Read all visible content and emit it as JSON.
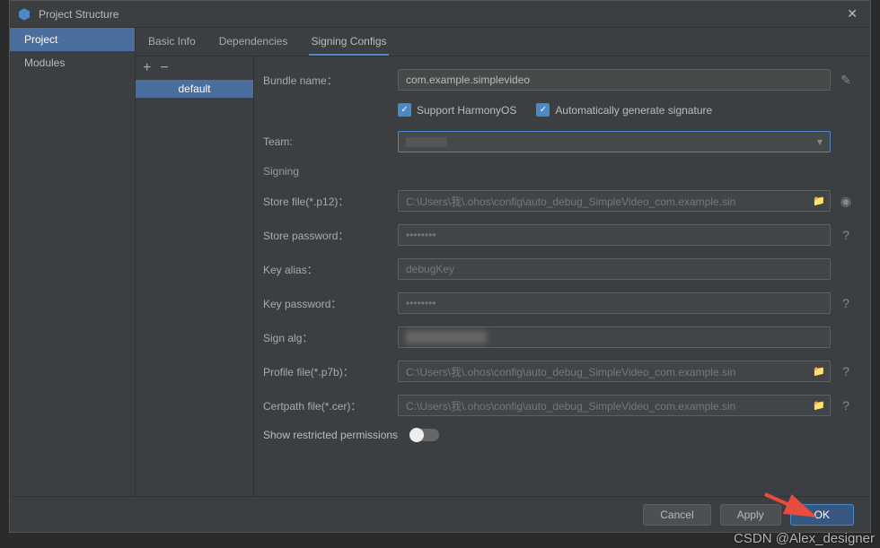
{
  "window": {
    "title": "Project Structure"
  },
  "leftNav": {
    "items": [
      "Project",
      "Modules"
    ],
    "selected": 0
  },
  "tabs": {
    "items": [
      "Basic Info",
      "Dependencies",
      "Signing Configs"
    ],
    "active": 2
  },
  "configs": {
    "items": [
      "default"
    ],
    "selected": 0
  },
  "form": {
    "bundleName": {
      "label": "Bundle name：",
      "value": "com.example.simplevideo"
    },
    "supportHarmony": {
      "label": "Support HarmonyOS",
      "checked": true
    },
    "autoSign": {
      "label": "Automatically generate signature",
      "checked": true
    },
    "team": {
      "label": "Team:",
      "value": ""
    },
    "signingHeader": "Signing",
    "storeFile": {
      "label": "Store file(*.p12)：",
      "value": "C:\\Users\\我\\.ohos\\config\\auto_debug_SimpleVideo_com.example.sin"
    },
    "storePassword": {
      "label": "Store password：",
      "value": "••••••••"
    },
    "keyAlias": {
      "label": "Key alias：",
      "value": "debugKey"
    },
    "keyPassword": {
      "label": "Key password：",
      "value": "••••••••"
    },
    "signAlg": {
      "label": "Sign alg：",
      "value": ""
    },
    "profileFile": {
      "label": "Profile file(*.p7b)：",
      "value": "C:\\Users\\我\\.ohos\\config\\auto_debug_SimpleVideo_com.example.sin"
    },
    "certFile": {
      "label": "Certpath file(*.cer)：",
      "value": "C:\\Users\\我\\.ohos\\config\\auto_debug_SimpleVideo_com.example.sin"
    },
    "showRestricted": {
      "label": "Show restricted permissions",
      "on": false
    }
  },
  "footer": {
    "cancel": "Cancel",
    "apply": "Apply",
    "ok": "OK"
  },
  "watermark": "CSDN @Alex_designer"
}
